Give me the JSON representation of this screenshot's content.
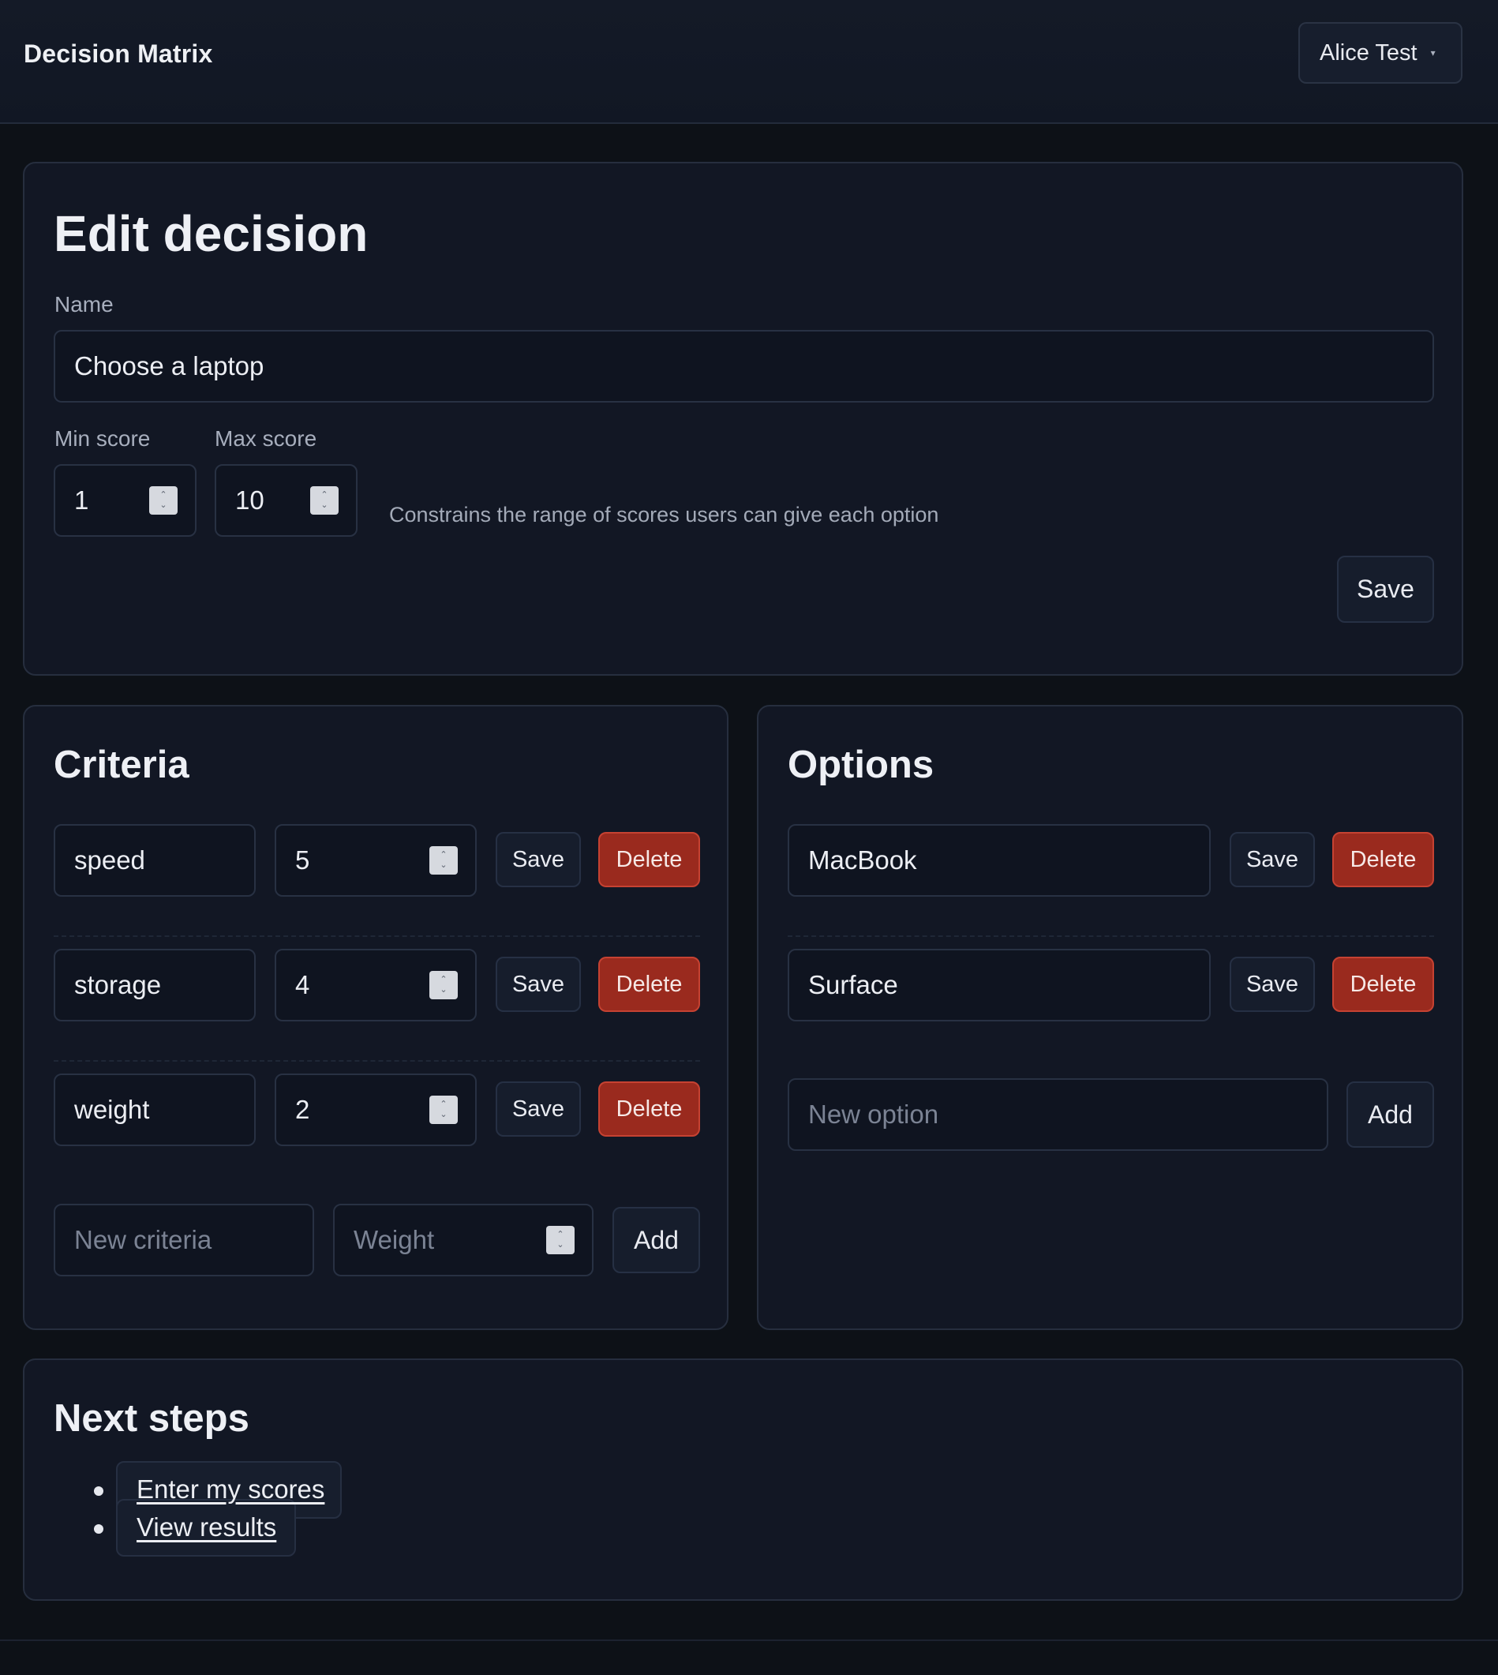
{
  "app": {
    "title": "Decision Matrix"
  },
  "user": {
    "name": "Alice Test",
    "caret": "▾"
  },
  "edit": {
    "heading": "Edit decision",
    "name_label": "Name",
    "name_value": "Choose a laptop",
    "min_label": "Min score",
    "min_value": "1",
    "max_label": "Max score",
    "max_value": "10",
    "hint": "Constrains the range of scores users can give each option",
    "save_label": "Save"
  },
  "criteria": {
    "heading": "Criteria",
    "items": [
      {
        "name": "speed",
        "weight": "5"
      },
      {
        "name": "storage",
        "weight": "4"
      },
      {
        "name": "weight",
        "weight": "2"
      }
    ],
    "save_label": "Save",
    "delete_label": "Delete",
    "new_placeholder": "New criteria",
    "weight_placeholder": "Weight",
    "add_label": "Add"
  },
  "options": {
    "heading": "Options",
    "items": [
      {
        "name": "MacBook"
      },
      {
        "name": "Surface"
      }
    ],
    "save_label": "Save",
    "delete_label": "Delete",
    "new_placeholder": "New option",
    "add_label": "Add"
  },
  "next": {
    "heading": "Next steps",
    "links": [
      "Enter my scores",
      "View results"
    ]
  },
  "colors": {
    "background": "#0d1117",
    "card": "#121724",
    "danger": "#9a2a1e"
  }
}
